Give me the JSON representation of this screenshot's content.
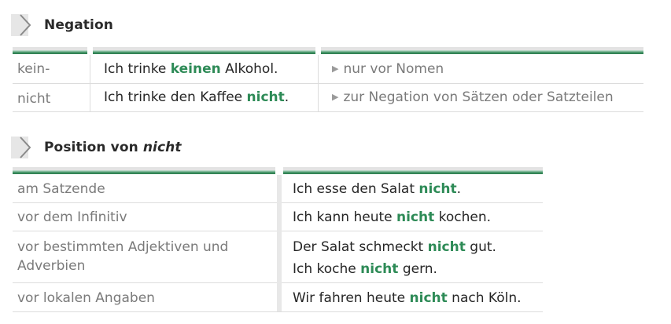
{
  "negation": {
    "title": "Negation",
    "rows": [
      {
        "form": "kein-",
        "ex_pre": "Ich trinke ",
        "ex_hl": "keinen",
        "ex_post": " Alkohol.",
        "note": "nur vor Nomen"
      },
      {
        "form": "nicht",
        "ex_pre": "Ich trinke den Kaffee ",
        "ex_hl": "nicht",
        "ex_post": ".",
        "note": "zur Negation von Sätzen oder Satzteilen"
      }
    ]
  },
  "position": {
    "title_pre": "Position von ",
    "title_em": "nicht",
    "rows": [
      {
        "label": "am Satzende",
        "l1_pre": "Ich esse den Salat ",
        "l1_hl": "nicht",
        "l1_post": "."
      },
      {
        "label": "vor dem Infinitiv",
        "l1_pre": "Ich kann heute ",
        "l1_hl": "nicht",
        "l1_post": " kochen."
      },
      {
        "label_l1": "vor bestimmten Adjektiven und",
        "label_l2": "Adverbien",
        "l1_pre": "Der Salat schmeckt ",
        "l1_hl": "nicht",
        "l1_post": " gut.",
        "l2_pre": "Ich koche ",
        "l2_hl": "nicht",
        "l2_post": " gern."
      },
      {
        "label": "vor lokalen Angaben",
        "l1_pre": "Wir fahren heute ",
        "l1_hl": "nicht",
        "l1_post": " nach Köln."
      }
    ]
  },
  "colors": {
    "accent": "#2e8b57",
    "muted": "#7a7a7a"
  },
  "icons": [
    "chevron-right-icon",
    "triangle-right-icon"
  ]
}
